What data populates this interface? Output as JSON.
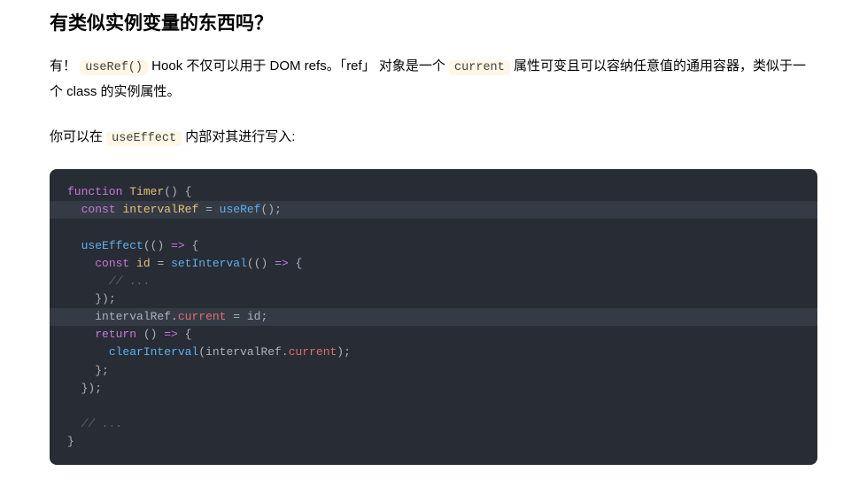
{
  "heading": "有类似实例变量的东西吗？",
  "para1": {
    "t1": "有！",
    "code1": "useRef()",
    "t2": " Hook 不仅可以用于 DOM refs。「ref」 对象是一个 ",
    "code2": "current",
    "t3": " 属性可变且可以容纳任意值的通用容器，类似于一个 class 的实例属性。"
  },
  "para2": {
    "t1": "你可以在 ",
    "code1": "useEffect",
    "t2": " 内部对其进行写入:"
  },
  "code": {
    "l1": {
      "kw": "function",
      "sp": " ",
      "fn": "Timer",
      "paren": "() ",
      "brace": "{"
    },
    "l2": {
      "ind": "  ",
      "kw": "const",
      "sp": " ",
      "var": "intervalRef",
      "eq": " = ",
      "call": "useRef",
      "paren": "()",
      "semi": ";"
    },
    "l3": "",
    "l4": {
      "ind": "  ",
      "call": "useEffect",
      "paren1": "(",
      "paren2": "() ",
      "arrow": "=>",
      "sp": " ",
      "brace": "{"
    },
    "l5": {
      "ind": "    ",
      "kw": "const",
      "sp": " ",
      "var": "id",
      "eq": " = ",
      "call": "setInterval",
      "paren1": "(",
      "paren2": "() ",
      "arrow": "=>",
      "sp2": " ",
      "brace": "{"
    },
    "l6": {
      "ind": "      ",
      "comment": "// ..."
    },
    "l7": {
      "ind": "    ",
      "brace": "});"
    },
    "l8": {
      "ind": "    ",
      "var": "intervalRef",
      "dot": ".",
      "prop": "current",
      "eq": " = ",
      "var2": "id",
      "semi": ";"
    },
    "l9": {
      "ind": "    ",
      "kw": "return",
      "sp": " ",
      "paren": "() ",
      "arrow": "=>",
      "sp2": " ",
      "brace": "{"
    },
    "l10": {
      "ind": "      ",
      "call": "clearInterval",
      "paren1": "(",
      "var": "intervalRef",
      "dot": ".",
      "prop": "current",
      "paren2": ")",
      "semi": ";"
    },
    "l11": {
      "ind": "    ",
      "brace": "};"
    },
    "l12": {
      "ind": "  ",
      "brace": "});"
    },
    "l13": "",
    "l14": {
      "ind": "  ",
      "comment": "// ..."
    },
    "l15": {
      "brace": "}"
    }
  }
}
